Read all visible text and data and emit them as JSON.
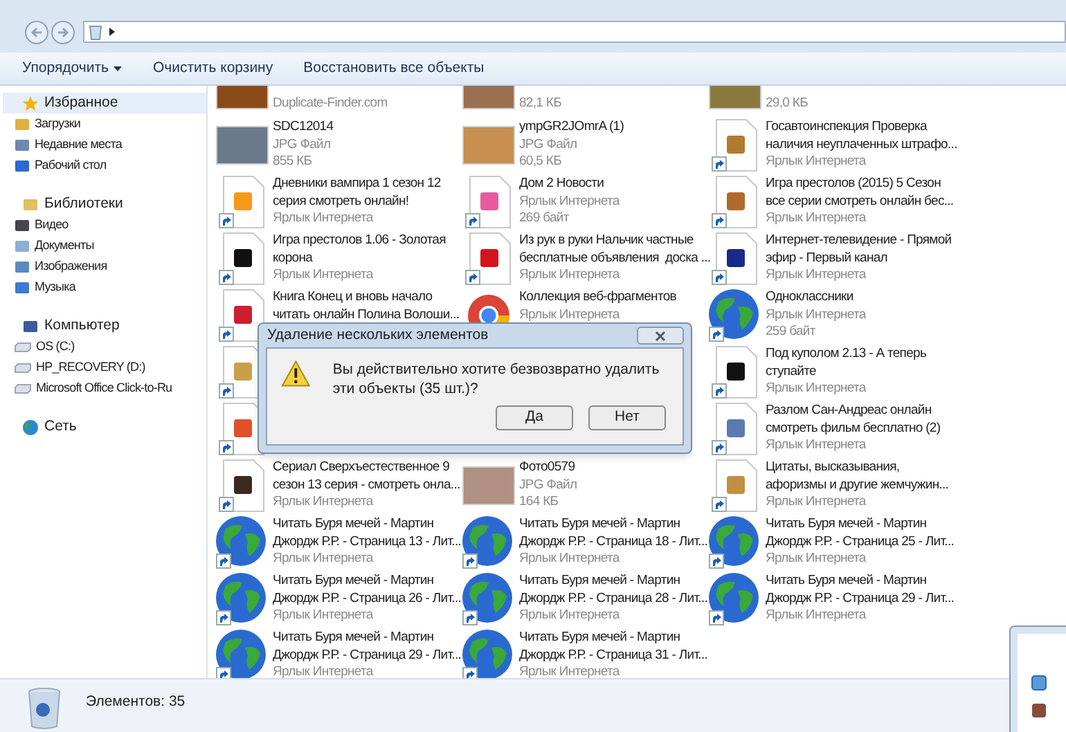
{
  "toolbar": {
    "items": [
      {
        "label": "Упорядочить",
        "has_menu": true
      },
      {
        "label": "Очистить корзину",
        "has_menu": false
      },
      {
        "label": "Восстановить все объекты",
        "has_menu": false
      }
    ]
  },
  "sidebar": {
    "groups": [
      {
        "label": "Избранное",
        "selected": true,
        "children": [
          {
            "label": "Загрузки",
            "selected": false
          },
          {
            "label": "Недавние места",
            "selected": false
          },
          {
            "label": "Рабочий стол",
            "selected": false
          }
        ]
      },
      {
        "label": "Библиотеки",
        "selected": false,
        "children": [
          {
            "label": "Видео",
            "selected": false
          },
          {
            "label": "Документы",
            "selected": false
          },
          {
            "label": "Изображения",
            "selected": false
          },
          {
            "label": "Музыка",
            "selected": false
          }
        ]
      },
      {
        "label": "Компьютер",
        "selected": false,
        "children": [
          {
            "label": "OS (C:)",
            "selected": false
          },
          {
            "label": "HP_RECOVERY (D:)",
            "selected": false
          },
          {
            "label": "Microsoft Office Click-to-Ru",
            "selected": false
          }
        ]
      },
      {
        "label": "Сеть",
        "selected": false
      }
    ]
  },
  "files": [
    {
      "kind": "photo",
      "color": "#8a4a1a",
      "details": [
        "Duplicate-Finder.com"
      ]
    },
    {
      "kind": "photo",
      "color": "#9a7050",
      "details": [
        "82,1 КБ"
      ]
    },
    {
      "kind": "photo",
      "color": "#8a7a40",
      "details": [
        "29,0 КБ"
      ]
    },
    {
      "kind": "photo",
      "color": "#6a7a8a",
      "name": [
        "SDC12014"
      ],
      "details": [
        "JPG Файл",
        "855 КБ"
      ]
    },
    {
      "kind": "photo",
      "color": "#c89050",
      "name": [
        "ympGR2JOmrA (1)"
      ],
      "details": [
        "JPG Файл",
        "60,5 КБ"
      ]
    },
    {
      "kind": "shortcut",
      "color": "#b07a30",
      "name": [
        "Госавтоинспекция Проверка",
        "наличия неуплаченных штрафо..."
      ],
      "details": [
        "Ярлык Интернета"
      ]
    },
    {
      "kind": "shortcut",
      "color": "#f59a1b",
      "name": [
        "Дневники вампира 1 сезон 12",
        "серия смотреть онлайн!"
      ],
      "details": [
        "Ярлык Интернета"
      ]
    },
    {
      "kind": "shortcut",
      "color": "#e85aa0",
      "name": [
        "Дом 2 Новости"
      ],
      "details": [
        "Ярлык Интернета",
        "269 байт"
      ]
    },
    {
      "kind": "shortcut",
      "color": "#b06a2a",
      "name": [
        "Игра престолов (2015) 5 Сезон",
        "все серии смотреть онлайн бес..."
      ],
      "details": [
        "Ярлык Интернета"
      ]
    },
    {
      "kind": "shortcut",
      "color": "#111111",
      "name": [
        "Игра престолов 1.06 - Золотая",
        "корона"
      ],
      "details": [
        "Ярлык Интернета"
      ]
    },
    {
      "kind": "shortcut",
      "color": "#d3141c",
      "name": [
        "Из рук в руки Нальчик частные",
        "бесплатные объявления  доска ..."
      ],
      "details": [
        "Ярлык Интернета"
      ]
    },
    {
      "kind": "shortcut",
      "color": "#1a2a8a",
      "name": [
        "Интернет-телевидение - Прямой",
        "эфир - Первый канал"
      ],
      "details": [
        "Ярлык Интернета"
      ]
    },
    {
      "kind": "shortcut",
      "color": "#cc1f2f",
      "name": [
        "Книга Конец и вновь начало",
        "читать онлайн Полина Волоши..."
      ]
    },
    {
      "kind": "chrome",
      "name": [
        "Коллекция веб-фрагментов"
      ],
      "details": [
        "Ярлык Интернета"
      ]
    },
    {
      "kind": "globe",
      "name": [
        "Одноклассники"
      ],
      "details": [
        "Ярлык Интернета",
        "259 байт"
      ]
    },
    {
      "kind": "shortcut",
      "color": "#c9a04a"
    },
    {
      "kind": "covered"
    },
    {
      "kind": "shortcut",
      "color": "#111111",
      "name": [
        "Под куполом 2.13 - А теперь",
        "ступайте"
      ],
      "details": [
        "Ярлык Интернета"
      ]
    },
    {
      "kind": "shortcut",
      "color": "#e0502a"
    },
    {
      "kind": "covered"
    },
    {
      "kind": "shortcut",
      "color": "#5a7ab0",
      "name": [
        "Разлом Сан-Андреас онлайн",
        "смотреть фильм бесплатно (2)"
      ],
      "details": [
        "Ярлык Интернета"
      ]
    },
    {
      "kind": "shortcut",
      "color": "#3a2a20",
      "name": [
        "Сериал Сверхъестественное 9",
        "сезон 13 серия - смотреть онла..."
      ],
      "details": [
        "Ярлык Интернета"
      ]
    },
    {
      "kind": "photo",
      "color": "#b09080",
      "name": [
        "Фото0579"
      ],
      "details": [
        "JPG Файл",
        "164 КБ"
      ]
    },
    {
      "kind": "shortcut",
      "color": "#c09040",
      "name": [
        "Цитаты, высказывания,",
        "афоризмы и другие жемчужин..."
      ],
      "details": [
        "Ярлык Интернета"
      ]
    },
    {
      "kind": "globe",
      "name": [
        "Читать Буря мечей - Мартин",
        "Джордж Р.Р. - Страница 13 - Лит..."
      ],
      "details": [
        "Ярлык Интернета"
      ]
    },
    {
      "kind": "globe",
      "name": [
        "Читать Буря мечей - Мартин",
        "Джордж Р.Р. - Страница 18 - Лит..."
      ],
      "details": [
        "Ярлык Интернета"
      ]
    },
    {
      "kind": "globe",
      "name": [
        "Читать Буря мечей - Мартин",
        "Джордж Р.Р. - Страница 25 - Лит..."
      ],
      "details": [
        "Ярлык Интернета"
      ]
    },
    {
      "kind": "globe",
      "name": [
        "Читать Буря мечей - Мартин",
        "Джордж Р.Р. - Страница 26 - Лит..."
      ],
      "details": [
        "Ярлык Интернета"
      ]
    },
    {
      "kind": "globe",
      "name": [
        "Читать Буря мечей - Мартин",
        "Джордж Р.Р. - Страница 28 - Лит..."
      ],
      "details": [
        "Ярлык Интернета"
      ]
    },
    {
      "kind": "globe",
      "name": [
        "Читать Буря мечей - Мартин",
        "Джордж Р.Р. - Страница 29 - Лит..."
      ],
      "details": [
        "Ярлык Интернета"
      ]
    },
    {
      "kind": "globe",
      "name": [
        "Читать Буря мечей - Мартин",
        "Джордж Р.Р. - Страница 29 - Лит..."
      ],
      "details": [
        "Ярлык Интернета"
      ]
    },
    {
      "kind": "globe",
      "name": [
        "Читать Буря мечей - Мартин",
        "Джордж Р.Р. - Страница 31 - Лит..."
      ],
      "details": [
        "Ярлык Интернета"
      ]
    }
  ],
  "dialog": {
    "title": "Удаление нескольких элементов",
    "message": "Вы действительно хотите безвозвратно удалить эти объекты (35 шт.)?",
    "buttons": [
      {
        "label": "Да",
        "selected": false
      },
      {
        "label": "Нет",
        "selected": false
      }
    ]
  },
  "status_bar": {
    "text": "Элементов: 35"
  }
}
